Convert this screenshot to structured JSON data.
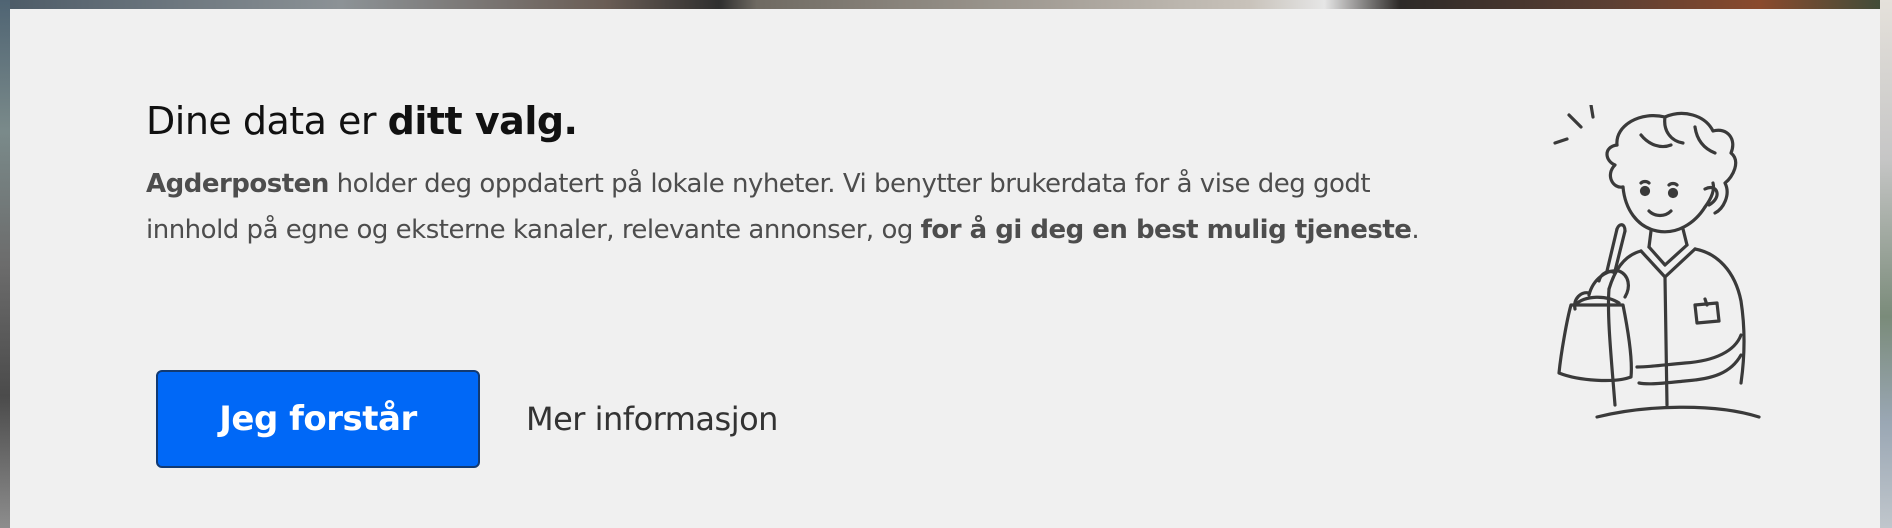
{
  "consent_dialog": {
    "heading_regular": "Dine data er ",
    "heading_bold": "ditt valg.",
    "body": {
      "brand": "Agderposten",
      "text_1": " holder deg oppdatert på lokale nyheter. Vi benytter brukerdata for å vise deg godt innhold på egne og eksterne kanaler, relevante annonser, og ",
      "emphasis": "for å gi deg en best mulig tjeneste",
      "text_2": "."
    },
    "accept_button_label": "Jeg forstår",
    "more_info_label": "Mer informasjon",
    "illustration_icon": "person-writing-notes-icon"
  },
  "colors": {
    "dialog_background": "#f0f0f0",
    "primary_button": "#0068f7",
    "primary_button_border": "#123a72",
    "heading_text": "#111111",
    "body_text": "#4d4d4d"
  }
}
